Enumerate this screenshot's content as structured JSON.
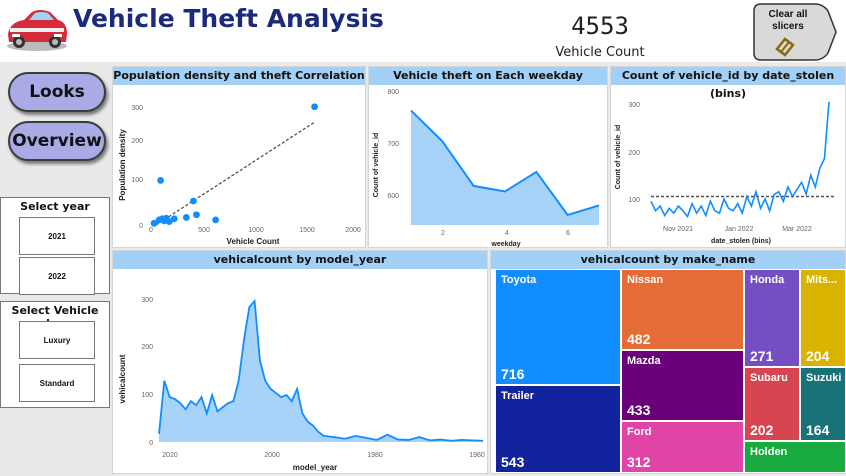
{
  "header": {
    "title": "Vehicle Theft Analysis",
    "kpi_value": "4553",
    "kpi_label": "Vehicle Count",
    "clear_label": "Clear all slicers"
  },
  "nav": {
    "looks": "Looks",
    "overview": "Overview"
  },
  "slicers": {
    "year": {
      "title": "Select year",
      "options": [
        "2021",
        "2022"
      ]
    },
    "vclass": {
      "title": "Select Vehicle class",
      "options": [
        "Luxury",
        "Standard"
      ]
    }
  },
  "charts": {
    "scatter": {
      "title": "Population density and theft Correlation",
      "xlabel": "Vehicle Count",
      "ylabel": "Population density",
      "xticks": [
        "0",
        "500",
        "1000",
        "1500",
        "2000"
      ],
      "yticks": [
        "0",
        "100",
        "200",
        "300"
      ]
    },
    "weekday": {
      "title": "Vehicle theft on Each weekday",
      "xlabel": "weekday",
      "ylabel": "Count of vehicle_id",
      "xticks": [
        "2",
        "4",
        "6"
      ],
      "yticks": [
        "600",
        "700",
        "800"
      ]
    },
    "bins": {
      "title": "Count of vehicle_id by date_stolen (bins)",
      "xlabel": "date_stolen (bins)",
      "ylabel": "Count of vehicle_id",
      "xticks": [
        "Nov 2021",
        "Jan 2022",
        "Mar 2022"
      ],
      "yticks": [
        "100",
        "200",
        "300"
      ]
    },
    "model": {
      "title": "vehicalcount by model_year",
      "xlabel": "model_year",
      "ylabel": "vehicalcount",
      "xticks": [
        "2020",
        "2000",
        "1980",
        "1960"
      ],
      "yticks": [
        "0",
        "100",
        "200",
        "300"
      ]
    },
    "make": {
      "title": "vehicalcount by make_name",
      "items": [
        {
          "name": "Toyota",
          "value": "716",
          "color": "#118dff"
        },
        {
          "name": "Trailer",
          "value": "543",
          "color": "#12239e"
        },
        {
          "name": "Nissan",
          "value": "482",
          "color": "#e66c37"
        },
        {
          "name": "Mazda",
          "value": "433",
          "color": "#6b007b"
        },
        {
          "name": "Ford",
          "value": "312",
          "color": "#e044a7"
        },
        {
          "name": "Honda",
          "value": "271",
          "color": "#744ec2"
        },
        {
          "name": "Mits...",
          "value": "204",
          "color": "#d9b300"
        },
        {
          "name": "Subaru",
          "value": "202",
          "color": "#d64550"
        },
        {
          "name": "Suzuki",
          "value": "164",
          "color": "#197278"
        },
        {
          "name": "Holden",
          "value": "",
          "color": "#1aab40"
        }
      ]
    }
  },
  "chart_data": [
    {
      "type": "scatter",
      "title": "Population density and theft Correlation",
      "xlabel": "Vehicle Count",
      "ylabel": "Population density",
      "xlim": [
        0,
        2000
      ],
      "ylim": [
        0,
        350
      ],
      "points": [
        [
          30,
          5
        ],
        [
          80,
          15
        ],
        [
          95,
          130
        ],
        [
          110,
          18
        ],
        [
          130,
          12
        ],
        [
          150,
          20
        ],
        [
          180,
          10
        ],
        [
          230,
          18
        ],
        [
          350,
          22
        ],
        [
          420,
          70
        ],
        [
          450,
          30
        ],
        [
          640,
          15
        ],
        [
          1620,
          345
        ]
      ],
      "trendline": [
        [
          50,
          0
        ],
        [
          1620,
          300
        ]
      ],
      "color": "#118dff"
    },
    {
      "type": "area",
      "title": "Vehicle theft on Each weekday",
      "xlabel": "weekday",
      "ylabel": "Count of vehicle_id",
      "x": [
        1,
        2,
        3,
        4,
        5,
        6,
        7
      ],
      "values": [
        765,
        710,
        630,
        620,
        655,
        578,
        595
      ],
      "ylim": [
        560,
        800
      ],
      "color": "#118dff"
    },
    {
      "type": "line",
      "title": "Count of vehicle_id by date_stolen (bins)",
      "xlabel": "date_stolen (bins)",
      "ylabel": "Count of vehicle_id",
      "values": [
        120,
        100,
        110,
        90,
        105,
        95,
        110,
        100,
        88,
        115,
        95,
        110,
        90,
        120,
        100,
        95,
        125,
        105,
        100,
        115,
        95,
        130,
        110,
        140,
        105,
        125,
        100,
        135,
        140,
        120,
        150,
        130,
        145,
        160,
        135,
        175,
        150,
        190,
        210,
        330
      ],
      "average": 130,
      "ylim": [
        70,
        340
      ],
      "color": "#118dff"
    },
    {
      "type": "area",
      "title": "vehicalcount by model_year",
      "xlabel": "model_year",
      "ylabel": "vehicalcount",
      "x": [
        2021,
        2020,
        2019,
        2018,
        2017,
        2016,
        2015,
        2014,
        2013,
        2012,
        2011,
        2010,
        2009,
        2008,
        2007,
        2006,
        2005,
        2004,
        2003,
        2002,
        2001,
        2000,
        1999,
        1998,
        1997,
        1996,
        1995,
        1994,
        1993,
        1992,
        1991,
        1990,
        1988,
        1986,
        1984,
        1982,
        1980,
        1978,
        1976,
        1974,
        1972,
        1970,
        1968,
        1966,
        1964,
        1962,
        1960
      ],
      "values": [
        20,
        150,
        110,
        105,
        95,
        80,
        100,
        90,
        110,
        70,
        115,
        75,
        85,
        95,
        100,
        150,
        250,
        330,
        345,
        200,
        150,
        130,
        120,
        110,
        115,
        100,
        130,
        70,
        50,
        40,
        25,
        15,
        12,
        8,
        15,
        10,
        5,
        18,
        6,
        5,
        12,
        4,
        6,
        3,
        5,
        4,
        3
      ],
      "ylim": [
        0,
        350
      ],
      "color": "#118dff"
    },
    {
      "type": "treemap",
      "title": "vehicalcount by make_name",
      "categories": [
        "Toyota",
        "Trailer",
        "Nissan",
        "Mazda",
        "Ford",
        "Honda",
        "Mits...",
        "Subaru",
        "Suzuki",
        "Holden"
      ],
      "values": [
        716,
        543,
        482,
        433,
        312,
        271,
        204,
        202,
        164,
        null
      ]
    }
  ]
}
